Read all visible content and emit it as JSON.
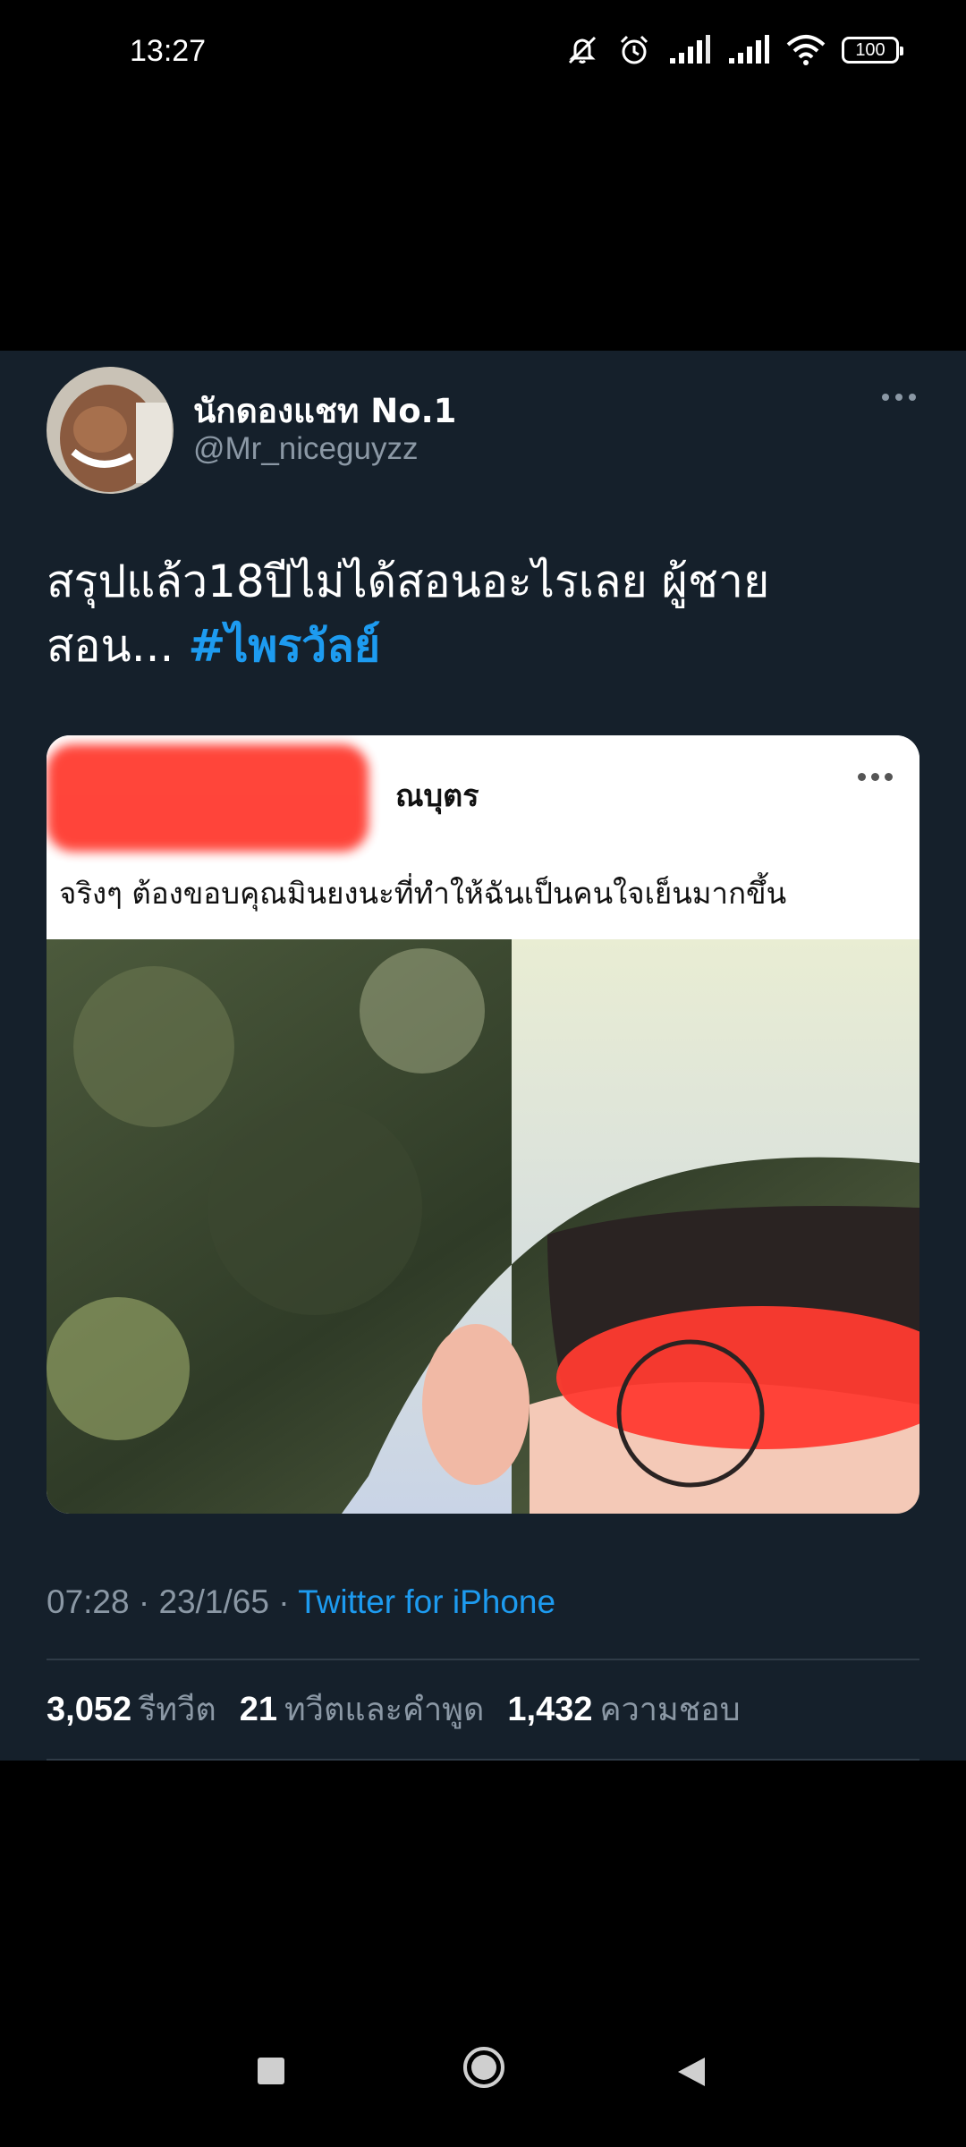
{
  "status_bar": {
    "time": "13:27",
    "battery": "100"
  },
  "tweet": {
    "display_name": "นักดองแชท No.1",
    "handle": "@Mr_niceguyzz",
    "text_line1": "สรุปแล้ว18ปีไม่ได้สอนอะไรเลย ผู้ชาย",
    "text_line2": "สอน... ",
    "hashtag": "#ไพรวัลย์",
    "embed": {
      "name_suffix": "ณบุตร",
      "post_text": "จริงๆ ต้องขอบคุณมินยงนะที่ทำให้ฉันเป็นคนใจเย็นมากขึ้น"
    },
    "time": "07:28",
    "date": "23/1/65",
    "source": "Twitter for iPhone",
    "retweets_count": "3,052",
    "retweets_label": "รีทวีต",
    "quotes_count": "21",
    "quotes_label": "ทวีตและคำพูด",
    "likes_count": "1,432",
    "likes_label": "ความชอบ"
  },
  "colors": {
    "background": "#000000",
    "card": "#15202b",
    "accent": "#1d9bf0",
    "muted": "#8b98a5"
  }
}
